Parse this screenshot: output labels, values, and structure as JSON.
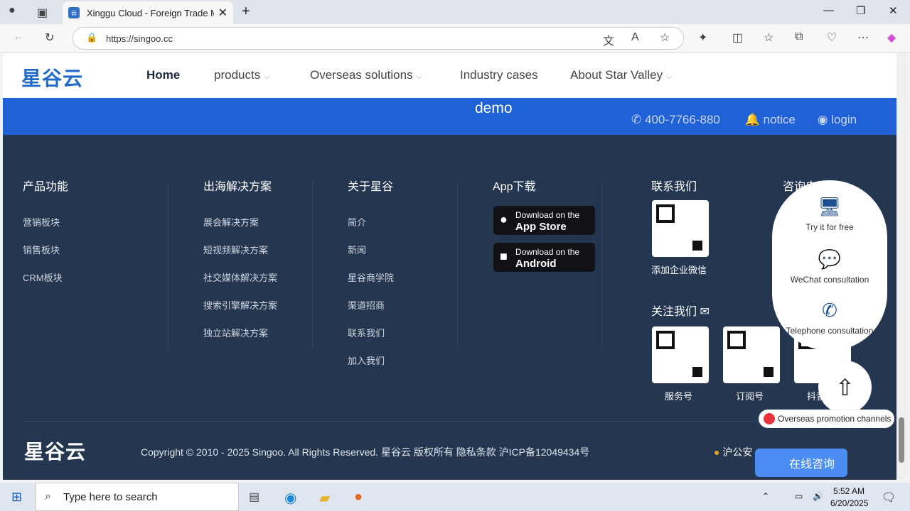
{
  "browser": {
    "tab_title": "Xinggu Cloud - Foreign Trade Ma",
    "url": "https://singoo.cc"
  },
  "nav": {
    "logo": "星谷云",
    "items": [
      "Home",
      "products",
      "Overseas solutions",
      "Industry cases",
      "About Star Valley"
    ]
  },
  "banner": {
    "demo": "demo",
    "phone": "400-7766-880",
    "notice": "notice",
    "login": "login"
  },
  "footer": {
    "col1": {
      "title": "产品功能",
      "links": [
        "营销板块",
        "销售板块",
        "CRM板块"
      ]
    },
    "col2": {
      "title": "出海解决方案",
      "links": [
        "展会解决方案",
        "短视频解决方案",
        "社交媒体解决方案",
        "搜索引擎解决方案",
        "独立站解决方案"
      ]
    },
    "col3": {
      "title": "关于星谷",
      "links": [
        "简介",
        "新闻",
        "星谷商学院",
        "渠道招商",
        "联系我们",
        "加入我们"
      ]
    },
    "col4": {
      "title": "App下载",
      "appstore_small": "Download on the",
      "appstore_big": "App Store",
      "android_small": "Download on the",
      "android_big": "Android"
    },
    "col5": {
      "title": "联系我们",
      "qr_label": "添加企业微信",
      "follow": "关注我们",
      "qr1": "服务号",
      "qr2": "订阅号",
      "qr3": "抖音"
    },
    "col6": {
      "title": "咨询电话"
    },
    "copyright": "Copyright © 2010 - 2025 Singoo. All Rights Reserved. 星谷云 版权所有 隐私条款 沪ICP备12049434号",
    "police": "沪公安"
  },
  "float": {
    "try": "Try it for free",
    "wechat": "WeChat consultation",
    "tel": "Telephone consultation",
    "promo": "Overseas promotion channels",
    "chat": "在线咨询"
  },
  "taskbar": {
    "search": "Type here to search",
    "time": "5:52 AM",
    "date": "6/20/2025"
  }
}
